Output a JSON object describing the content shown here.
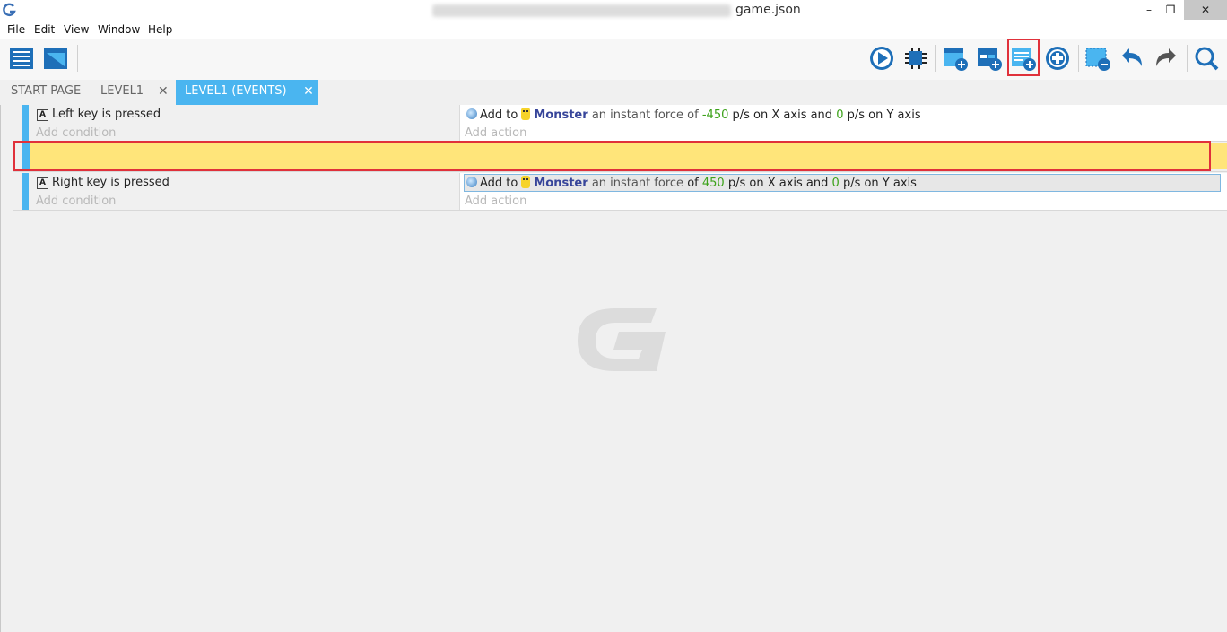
{
  "window": {
    "title": "game.json",
    "minimize_symbol": "–",
    "restore_symbol": "❐",
    "close_symbol": "✕"
  },
  "menu": [
    "File",
    "Edit",
    "View",
    "Window",
    "Help"
  ],
  "toolbar": {
    "left_icons": [
      "project-manager-icon",
      "window-view-icon"
    ],
    "right_icons": [
      "play-icon",
      "debug-icon",
      "add-event-icon",
      "add-subevent-icon",
      "add-comment-icon",
      "add-new-icon",
      "delete-event-icon",
      "undo-icon",
      "redo-icon",
      "search-icon"
    ],
    "highlighted_icon": "add-comment-icon",
    "highlight_color": "#e0313b"
  },
  "tabs": [
    {
      "label": "START PAGE",
      "active": false
    },
    {
      "label": "LEVEL1",
      "active": false,
      "close": "✕"
    },
    {
      "label": "LEVEL1 (EVENTS)",
      "active": true,
      "close": "✕"
    }
  ],
  "colors": {
    "accent": "#4ab5f0",
    "comment_background": "#ffe57a",
    "number_green": "#3ca21a",
    "object_blue": "#37459a",
    "highlight_red": "#e0313b"
  },
  "events": [
    {
      "condition": {
        "icon": "keyboard-icon",
        "key": "Left",
        "text": "key is pressed"
      },
      "add_condition": "Add condition",
      "action": {
        "prefix": "Add to",
        "object": "Monster",
        "mid": "an instant force of",
        "x_value": "-450",
        "x_unit": "p/s on X axis and",
        "y_value": "0",
        "y_unit": "p/s on Y axis"
      },
      "add_action": "Add action"
    },
    {
      "condition": {
        "icon": "keyboard-icon",
        "key": "Right",
        "text": "key is pressed"
      },
      "add_condition": "Add condition",
      "action": {
        "prefix": "Add to",
        "object": "Monster",
        "mid": "an instant force",
        "x_prefix": "of",
        "x_value": "450",
        "x_unit": "p/s on X axis and",
        "y_value": "0",
        "y_unit": "p/s on Y axis",
        "selected": true
      },
      "add_action": "Add action"
    }
  ],
  "comment_row": {
    "text": "",
    "highlighted": true
  }
}
